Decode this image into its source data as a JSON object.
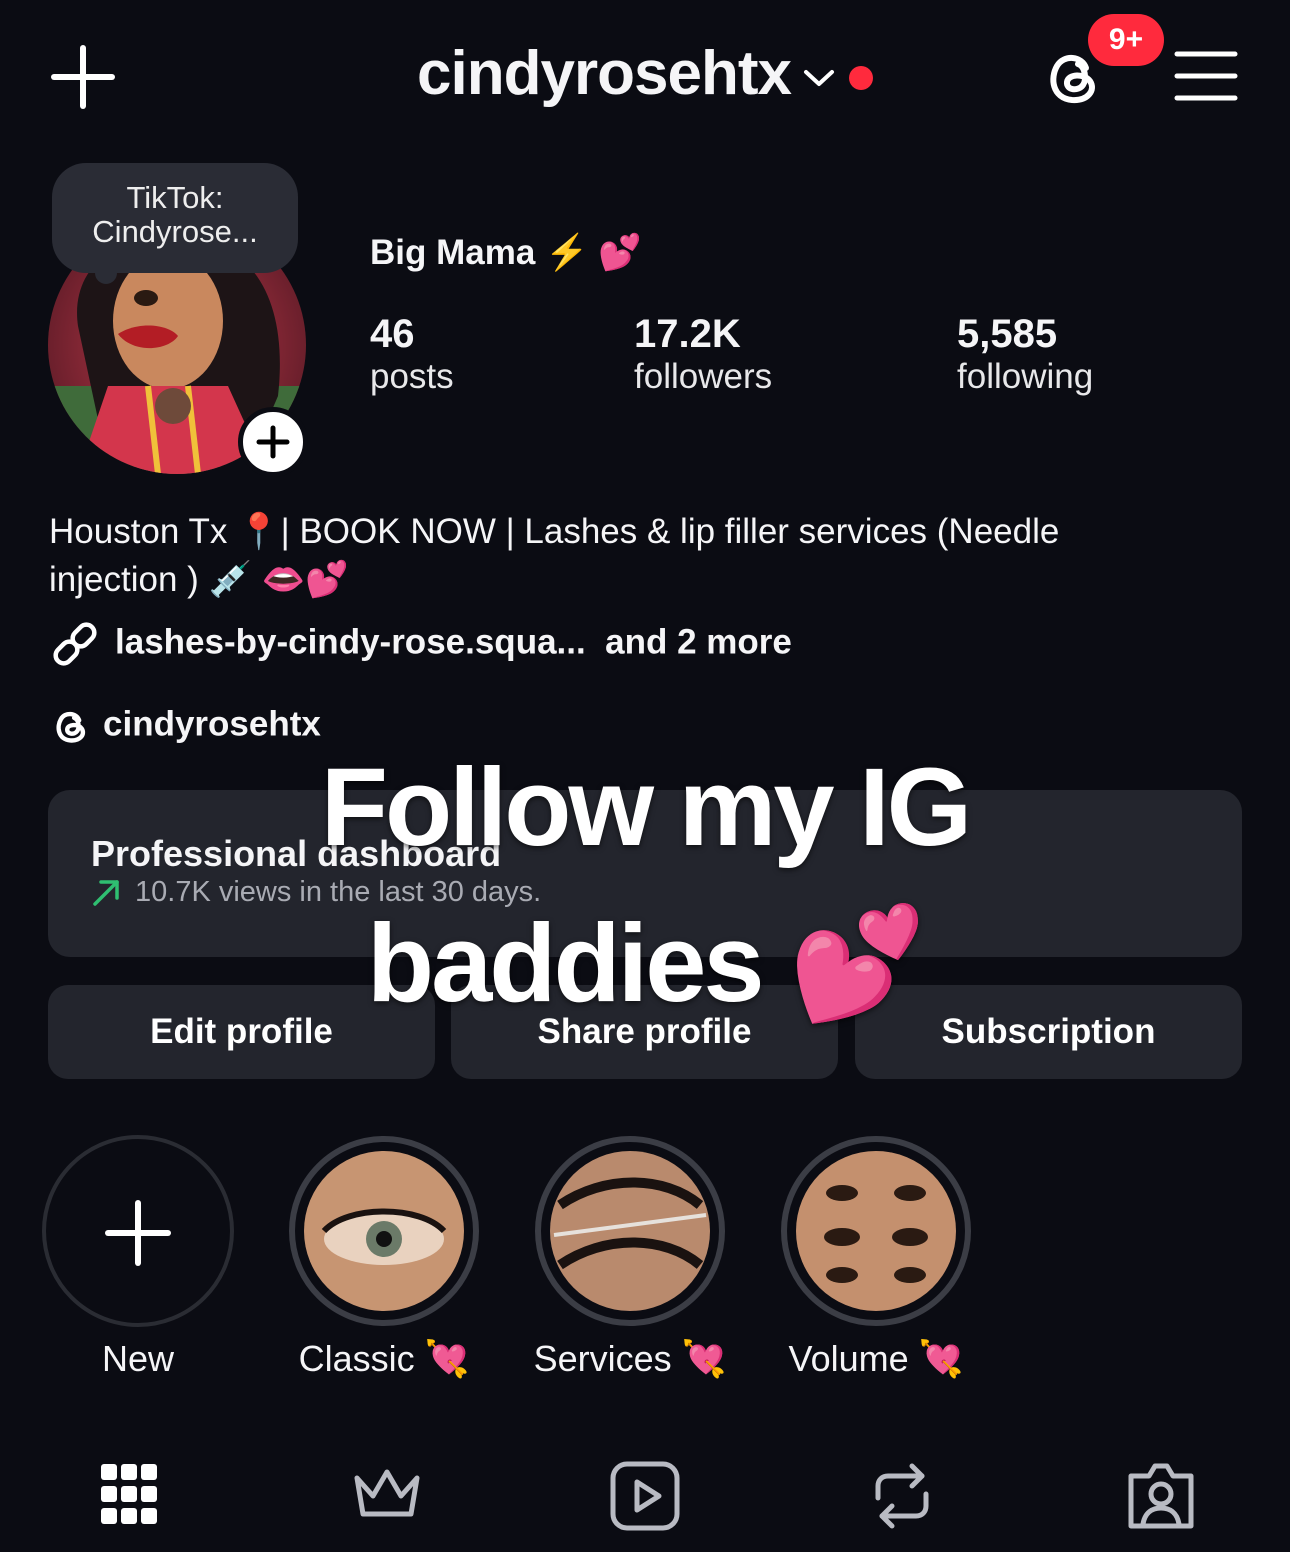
{
  "header": {
    "username": "cindyrosehtx",
    "notification_badge": "9+"
  },
  "profile": {
    "note": "TikTok: Cindyrose...",
    "display_name": "Big Mama ⚡️ 💕",
    "stats": [
      {
        "value": "46",
        "label": "posts"
      },
      {
        "value": "17.2K",
        "label": "followers"
      },
      {
        "value": "5,585",
        "label": "following"
      }
    ],
    "bio_line1": "Houston Tx 📍| BOOK NOW | Lashes & lip filler services (Needle",
    "bio_line2": "injection ) 💉 👄💕",
    "link_text": "lashes-by-cindy-rose.squa...",
    "link_more": "and 2 more",
    "threads_handle": "cindyrosehtx"
  },
  "dashboard": {
    "title": "Professional dashboard",
    "subtitle": "10.7K views in the last 30 days."
  },
  "buttons": {
    "edit": "Edit profile",
    "share": "Share profile",
    "subscription": "Subscription"
  },
  "caption": {
    "line1": "Follow my IG",
    "line2": "baddies 💕"
  },
  "highlights": [
    {
      "label": "New"
    },
    {
      "label": "Classic 💘"
    },
    {
      "label": "Services 💘"
    },
    {
      "label": "Volume 💘"
    }
  ],
  "colors": {
    "background": "#0b0c13",
    "surface": "#23252d",
    "accent_red": "#ff2a3d",
    "trend_green": "#2fbf71"
  }
}
